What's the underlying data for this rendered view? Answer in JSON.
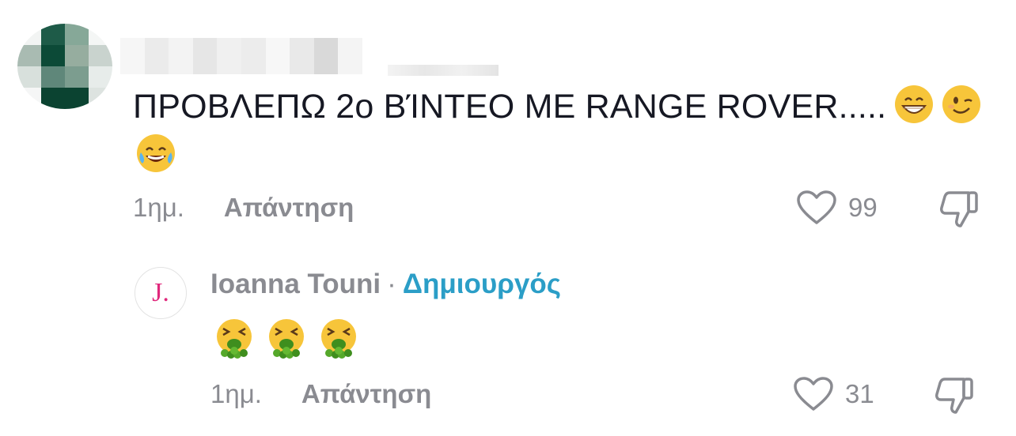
{
  "comment": {
    "text": "ΠΡΟΒΛΕΠΩ 2ο ΒΊΝΤΕΟ ΜΕ RANGE ROVER.....",
    "emojis": [
      "grinning-face",
      "winking-face",
      "face-with-tears-of-joy"
    ],
    "time": "1ημ.",
    "reply_label": "Απάντηση",
    "like_count": "99"
  },
  "reply": {
    "avatar_letter": "J",
    "avatar_dot": ".",
    "author": "Ioanna Touni",
    "separator": "·",
    "creator_label": "Δημιουργός",
    "emojis": [
      "vomiting-face",
      "vomiting-face",
      "vomiting-face"
    ],
    "time": "1ημ.",
    "reply_label": "Απάντηση",
    "like_count": "31"
  },
  "colors": {
    "text": "#161823",
    "muted": "#8a8b91",
    "creator": "#2b9ec7",
    "avatar_letter": "#e0287c"
  }
}
